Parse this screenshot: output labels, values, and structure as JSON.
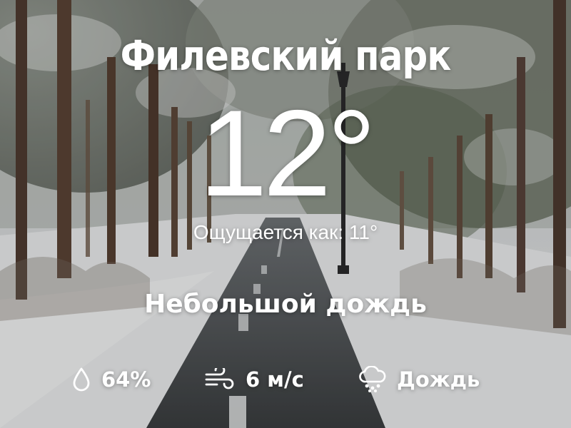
{
  "weather": {
    "location": "Филевский парк",
    "temperature": "12°",
    "feels_like": "Ощущается как: 11°",
    "condition": "Небольшой дождь",
    "humidity": "64%",
    "wind": "6 м/с",
    "precipitation": "Дождь"
  },
  "icons": {
    "humidity": "water-drop-icon",
    "wind": "wind-icon",
    "precipitation": "rain-cloud-icon"
  },
  "colors": {
    "text": "#ffffff",
    "snow": "#e8eaec",
    "trees": "#4a3a30",
    "road": "#3a3d3f"
  }
}
